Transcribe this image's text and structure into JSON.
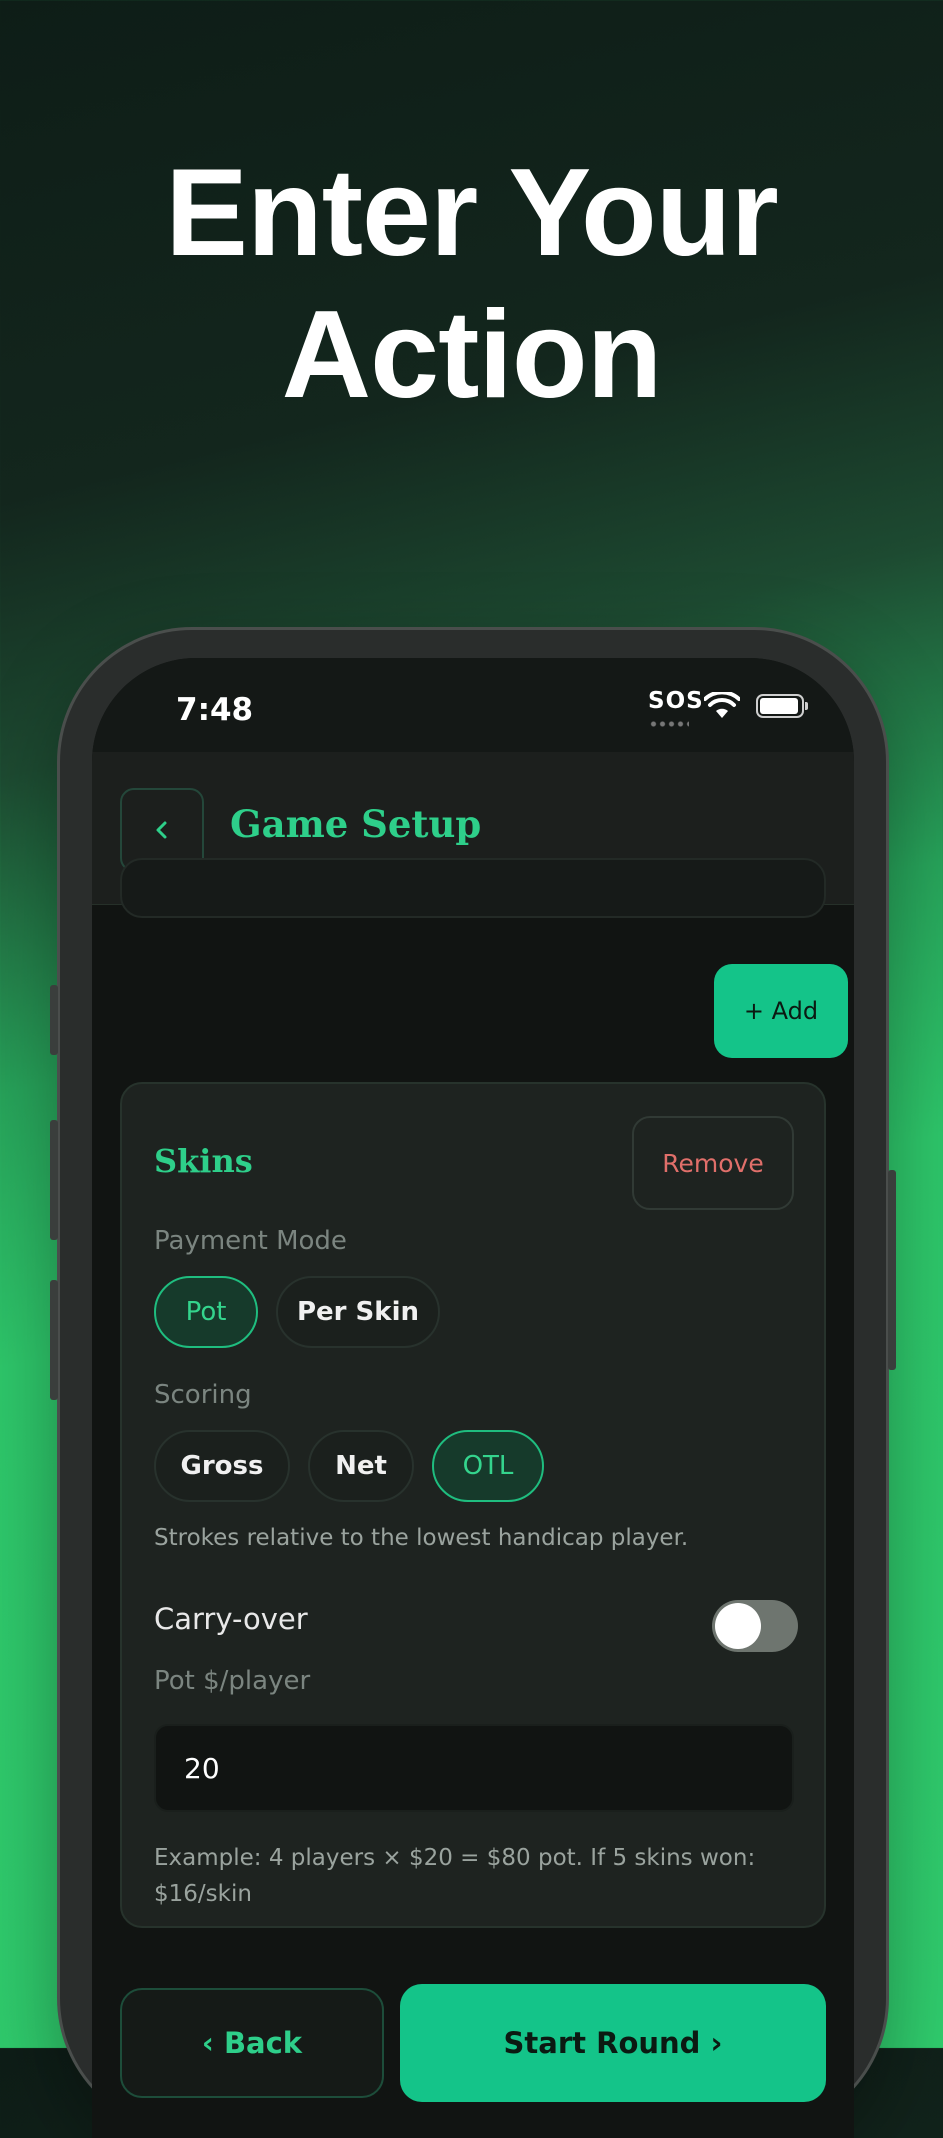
{
  "hero": {
    "line1": "Enter Your",
    "line2": "Action"
  },
  "status_bar": {
    "time": "7:48",
    "sos": "SOS"
  },
  "header": {
    "back_icon": "chevron-left-icon",
    "title": "Game Setup"
  },
  "add_button": "+ Add",
  "game_card": {
    "title": "Skins",
    "remove_label": "Remove",
    "payment_mode": {
      "label": "Payment Mode",
      "options": [
        "Pot",
        "Per Skin"
      ],
      "selected": "Pot"
    },
    "scoring": {
      "label": "Scoring",
      "options": [
        "Gross",
        "Net",
        "OTL"
      ],
      "selected": "OTL",
      "hint": "Strokes relative to the lowest handicap player."
    },
    "carry_over": {
      "label": "Carry-over",
      "enabled": false
    },
    "pot": {
      "label": "Pot $/player",
      "value": "20",
      "example": "Example: 4 players × $20 = $80 pot. If 5 skins won: $16/skin"
    }
  },
  "footer": {
    "back_label": "‹ Back",
    "start_label": "Start Round ›"
  },
  "colors": {
    "accent": "#14c489",
    "title_green": "#2ecf8a",
    "danger": "#e06f6a",
    "background": "#111412"
  }
}
